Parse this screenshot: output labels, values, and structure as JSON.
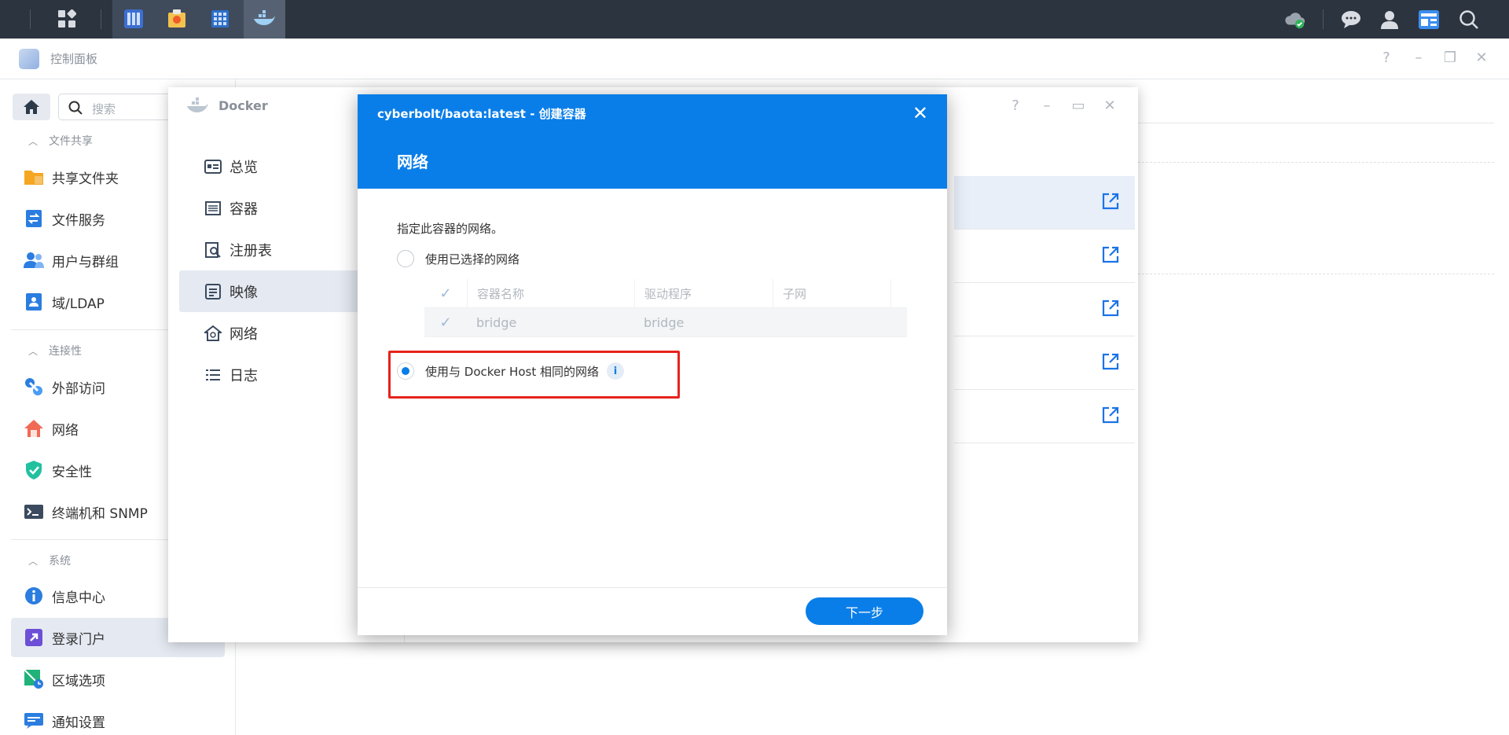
{
  "taskbar": {
    "apps": [
      "main-menu-icon",
      "storage-manager-icon",
      "package-center-icon",
      "resource-monitor-icon",
      "docker-icon"
    ],
    "right": [
      "cloud-sync-icon",
      "chat-icon",
      "user-icon",
      "widgets-icon",
      "search-icon"
    ]
  },
  "control_panel": {
    "title": "控制面板",
    "search_placeholder": "搜索",
    "sections": [
      {
        "label": "文件共享",
        "items": [
          "共享文件夹",
          "文件服务",
          "用户与群组",
          "域/LDAP"
        ]
      },
      {
        "label": "连接性",
        "items": [
          "外部访问",
          "网络",
          "安全性",
          "终端机和 SNMP"
        ]
      },
      {
        "label": "系统",
        "items": [
          "信息中心",
          "登录门户",
          "区域选项",
          "通知设置"
        ]
      }
    ],
    "active_item": "登录门户"
  },
  "docker": {
    "title": "Docker",
    "nav": [
      "总览",
      "容器",
      "注册表",
      "映像",
      "网络",
      "日志"
    ],
    "active_nav": "映像"
  },
  "modal": {
    "crumb": "cyberbolt/baota:latest - 创建容器",
    "heading": "网络",
    "description": "指定此容器的网络。",
    "option_selected_network": "使用已选择的网络",
    "table": {
      "headers": [
        "容器名称",
        "驱动程序",
        "子网"
      ],
      "rows": [
        [
          "bridge",
          "bridge",
          ""
        ]
      ]
    },
    "option_host_network": "使用与 Docker Host 相同的网络",
    "info_glyph": "i",
    "selected_option": "host",
    "next_button": "下一步"
  },
  "colors": {
    "accent": "#0a7ee8",
    "taskbar": "#2c3440",
    "highlight_border": "#e7231b"
  }
}
